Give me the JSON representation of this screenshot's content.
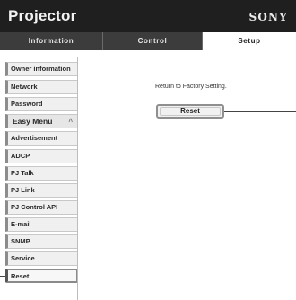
{
  "header": {
    "title": "Projector",
    "brand": "SONY"
  },
  "tabs": [
    {
      "label": "Information"
    },
    {
      "label": "Control"
    },
    {
      "label": "Setup"
    }
  ],
  "sidebar": {
    "items": [
      {
        "label": "Owner information"
      },
      {
        "label": "Network"
      },
      {
        "label": "Password"
      },
      {
        "label": "Easy Menu"
      },
      {
        "label": "Advertisement"
      },
      {
        "label": "ADCP"
      },
      {
        "label": "PJ Talk"
      },
      {
        "label": "PJ Link"
      },
      {
        "label": "PJ Control API"
      },
      {
        "label": "E-mail"
      },
      {
        "label": "SNMP"
      },
      {
        "label": "Service"
      },
      {
        "label": "Reset"
      }
    ],
    "selected": "Reset"
  },
  "main": {
    "description": "Return to Factory Setting.",
    "reset_button_label": "Reset"
  },
  "colors": {
    "header_bg": "#1f1f1f",
    "tab_bar_bg": "#3c3c3c",
    "active_tab_bg": "#ffffff"
  }
}
